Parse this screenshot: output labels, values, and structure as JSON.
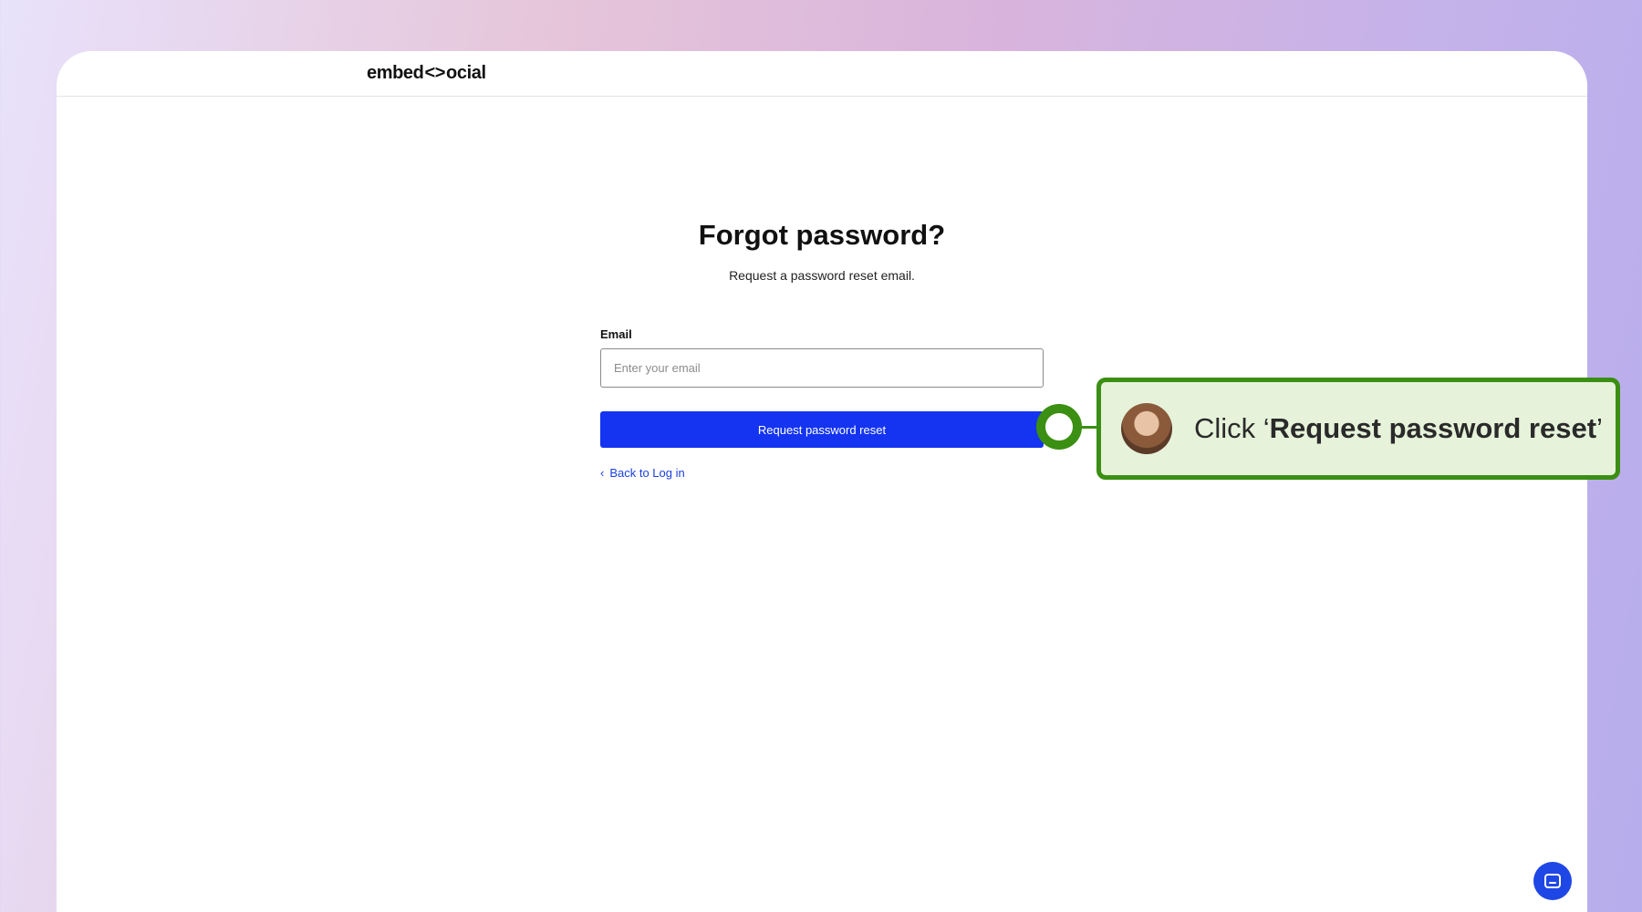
{
  "logo": {
    "left": "embed",
    "mark": "<>",
    "right": "ocial"
  },
  "page": {
    "title": "Forgot password?",
    "subtitle": "Request a password reset email."
  },
  "form": {
    "email_label": "Email",
    "email_placeholder": "Enter your email",
    "email_value": "",
    "submit_label": "Request password reset",
    "back_label": "Back to Log in"
  },
  "callout": {
    "prefix": "Click ‘",
    "bold": "Request password reset",
    "suffix": "’"
  },
  "colors": {
    "primary_button": "#1434f2",
    "link": "#1a3fe0",
    "callout_border": "#3b8f12",
    "callout_bg": "#e6f3da"
  },
  "icons": {
    "back": "chevron-left-icon",
    "chat": "chat-icon"
  }
}
